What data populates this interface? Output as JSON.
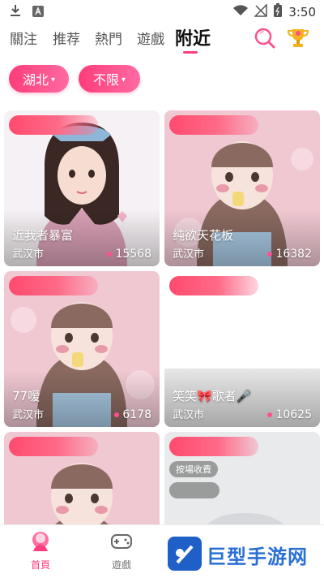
{
  "status_bar": {
    "time": "3:50"
  },
  "top_nav": {
    "tabs": [
      {
        "label": "關注"
      },
      {
        "label": "推荐"
      },
      {
        "label": "熱門"
      },
      {
        "label": "遊戲"
      },
      {
        "label": "附近"
      }
    ],
    "active_tab": "附近"
  },
  "filters": {
    "region": "湖北",
    "range": "不限"
  },
  "cards": [
    {
      "title": "近我者暴富",
      "city": "武汉市",
      "count": "15568"
    },
    {
      "title": "纯欲天花板",
      "city": "武汉市",
      "count": "16382"
    },
    {
      "title": "77嗳",
      "city": "武汉市",
      "count": "6178"
    },
    {
      "title": "笑笑🎀歌者🎤",
      "city": "武汉市",
      "count": "10625"
    },
    {
      "title": "",
      "city": "",
      "count": ""
    },
    {
      "title": "",
      "city": "",
      "count": "",
      "badge": "按場收費"
    }
  ],
  "bottom_nav": {
    "items": [
      {
        "label": "首頁"
      },
      {
        "label": "遊戲"
      }
    ]
  },
  "watermark": {
    "text": "巨型手游网"
  },
  "colors": {
    "accent": "#ff3d7f",
    "card_bg": "#f3c9d3"
  }
}
